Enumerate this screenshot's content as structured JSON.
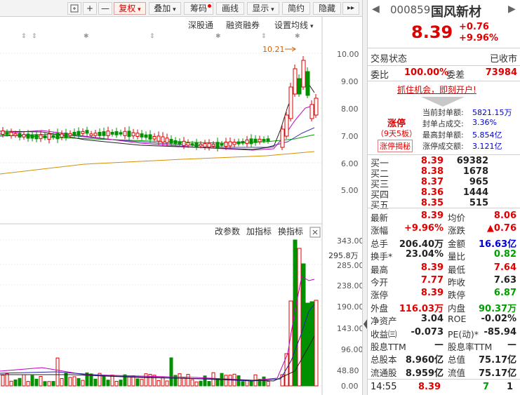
{
  "toolbar": {
    "buttons": [
      "复权",
      "叠加",
      "筹码",
      "画线",
      "显示",
      "简约",
      "隐藏"
    ],
    "more": "▸▸"
  },
  "kchart": {
    "menu": [
      "深股通",
      "融资融券",
      "设置均线"
    ],
    "price_ticks": [
      "10.00",
      "9.00",
      "8.00",
      "7.00",
      "6.00",
      "5.00"
    ],
    "high_marker": "10.21"
  },
  "vchart": {
    "menu": [
      "改参数",
      "加指标",
      "换指标"
    ],
    "volume_ticks": [
      "343.00",
      "285.00",
      "238.00",
      "190.00",
      "143.00",
      "96.00",
      "48.80",
      "0.00"
    ],
    "unit_label": "295.8万"
  },
  "colors": {
    "up": "#e00000",
    "down": "#009000",
    "ma5": "#202020",
    "ma10": "#d0a000",
    "ma20": "#c000c0",
    "ma60": "#00a000"
  },
  "header": {
    "code": "000859",
    "name": "国风新材",
    "price": "8.39",
    "change": "+0.76",
    "pct": "+9.96%"
  },
  "status": {
    "label": "交易状态",
    "value": "已收市"
  },
  "weibi": {
    "label": "委比",
    "value": "100.00%",
    "diff_label": "委差",
    "diff_value": "73984"
  },
  "promo": "抓住机会，即刻开户!",
  "limit": {
    "tag": "涨停",
    "days": "（9天5板）",
    "button": "涨停揭秘",
    "rows": [
      {
        "label": "当前封单额:",
        "value": "5821.15万"
      },
      {
        "label": "封单占成交:",
        "value": "3.36%"
      },
      {
        "label": "最高封单额:",
        "value": "5.854亿"
      },
      {
        "label": "涨停成交额:",
        "value": "3.121亿"
      }
    ]
  },
  "bids": [
    {
      "label": "买一",
      "price": "8.39",
      "vol": "69382"
    },
    {
      "label": "买二",
      "price": "8.38",
      "vol": "1678"
    },
    {
      "label": "买三",
      "price": "8.37",
      "vol": "965"
    },
    {
      "label": "买四",
      "price": "8.36",
      "vol": "1444"
    },
    {
      "label": "买五",
      "price": "8.35",
      "vol": "515"
    }
  ],
  "stats": [
    {
      "l1": "最新",
      "v1": "8.39",
      "c1": "red",
      "l2": "均价",
      "v2": "8.06",
      "c2": "red"
    },
    {
      "l1": "涨幅",
      "v1": "+9.96%",
      "c1": "red",
      "l2": "涨跌",
      "v2": "▲0.76",
      "c2": "red"
    },
    {
      "l1": "总手",
      "v1": "206.40万",
      "c1": "",
      "l2": "金额",
      "v2": "16.63亿",
      "c2": "blue"
    },
    {
      "l1": "换手*",
      "v1": "23.04%",
      "c1": "",
      "l2": "量比",
      "v2": "0.82",
      "c2": "green"
    },
    {
      "l1": "最高",
      "v1": "8.39",
      "c1": "red",
      "l2": "最低",
      "v2": "7.64",
      "c2": "red"
    },
    {
      "l1": "今开",
      "v1": "7.77",
      "c1": "red",
      "l2": "昨收",
      "v2": "7.63",
      "c2": ""
    },
    {
      "l1": "涨停",
      "v1": "8.39",
      "c1": "red",
      "l2": "跌停",
      "v2": "6.87",
      "c2": "green"
    },
    {
      "l1": "外盘",
      "v1": "116.03万",
      "c1": "red",
      "l2": "内盘",
      "v2": "90.37万",
      "c2": "green"
    },
    {
      "l1": "净资产",
      "v1": "3.04",
      "c1": "",
      "l2": "ROE",
      "v2": "-0.02%",
      "c2": ""
    },
    {
      "l1": "收益㈢",
      "v1": "-0.073",
      "c1": "",
      "l2": "PE(动)*",
      "v2": "-85.94",
      "c2": ""
    },
    {
      "l1": "股息TTM",
      "v1": "—",
      "c1": "",
      "l2": "股息率TTM",
      "v2": "—",
      "c2": ""
    },
    {
      "l1": "总股本",
      "v1": "8.960亿",
      "c1": "",
      "l2": "总值",
      "v2": "75.17亿",
      "c2": ""
    },
    {
      "l1": "流通股",
      "v1": "8.959亿",
      "c1": "",
      "l2": "流值",
      "v2": "75.17亿",
      "c2": ""
    }
  ],
  "tick": {
    "time": "14:55",
    "price": "8.39",
    "vol": "7",
    "count": "1"
  }
}
